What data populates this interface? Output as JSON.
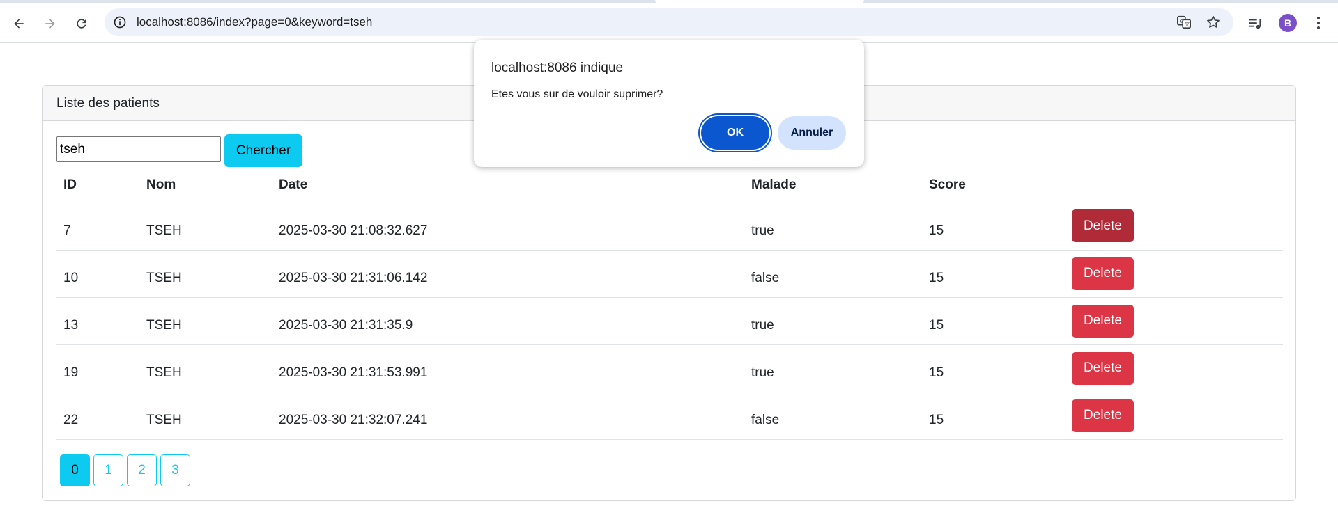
{
  "browser": {
    "url": "localhost:8086/index?page=0&keyword=tseh",
    "avatar_letter": "B",
    "icons": [
      "back-arrow-icon",
      "forward-arrow-icon",
      "reload-icon",
      "site-info-icon",
      "translate-icon",
      "bookmark-star-icon",
      "media-controls-icon",
      "kebab-menu-icon"
    ]
  },
  "dialog": {
    "title": "localhost:8086 indique",
    "message": "Etes vous sur de vouloir suprimer?",
    "ok_label": "OK",
    "cancel_label": "Annuler"
  },
  "card": {
    "header": "Liste des patients",
    "search": {
      "value": "tseh",
      "button_label": "Chercher"
    },
    "columns": [
      "ID",
      "Nom",
      "Date",
      "Malade",
      "Score"
    ],
    "delete_label": "Delete",
    "rows": [
      {
        "id": "7",
        "nom": "TSEH",
        "date": "2025-03-30 21:08:32.627",
        "malade": "true",
        "score": "15"
      },
      {
        "id": "10",
        "nom": "TSEH",
        "date": "2025-03-30 21:31:06.142",
        "malade": "false",
        "score": "15"
      },
      {
        "id": "13",
        "nom": "TSEH",
        "date": "2025-03-30 21:31:35.9",
        "malade": "true",
        "score": "15"
      },
      {
        "id": "19",
        "nom": "TSEH",
        "date": "2025-03-30 21:31:53.991",
        "malade": "true",
        "score": "15"
      },
      {
        "id": "22",
        "nom": "TSEH",
        "date": "2025-03-30 21:32:07.241",
        "malade": "false",
        "score": "15"
      }
    ],
    "pages": [
      "0",
      "1",
      "2",
      "3"
    ],
    "active_page": "0"
  },
  "colors": {
    "info": "#0dcaf0",
    "danger": "#dc3545",
    "danger_active": "#b02a37",
    "dialog_primary": "#0b57d0",
    "dialog_secondary": "#d3e3fd"
  }
}
